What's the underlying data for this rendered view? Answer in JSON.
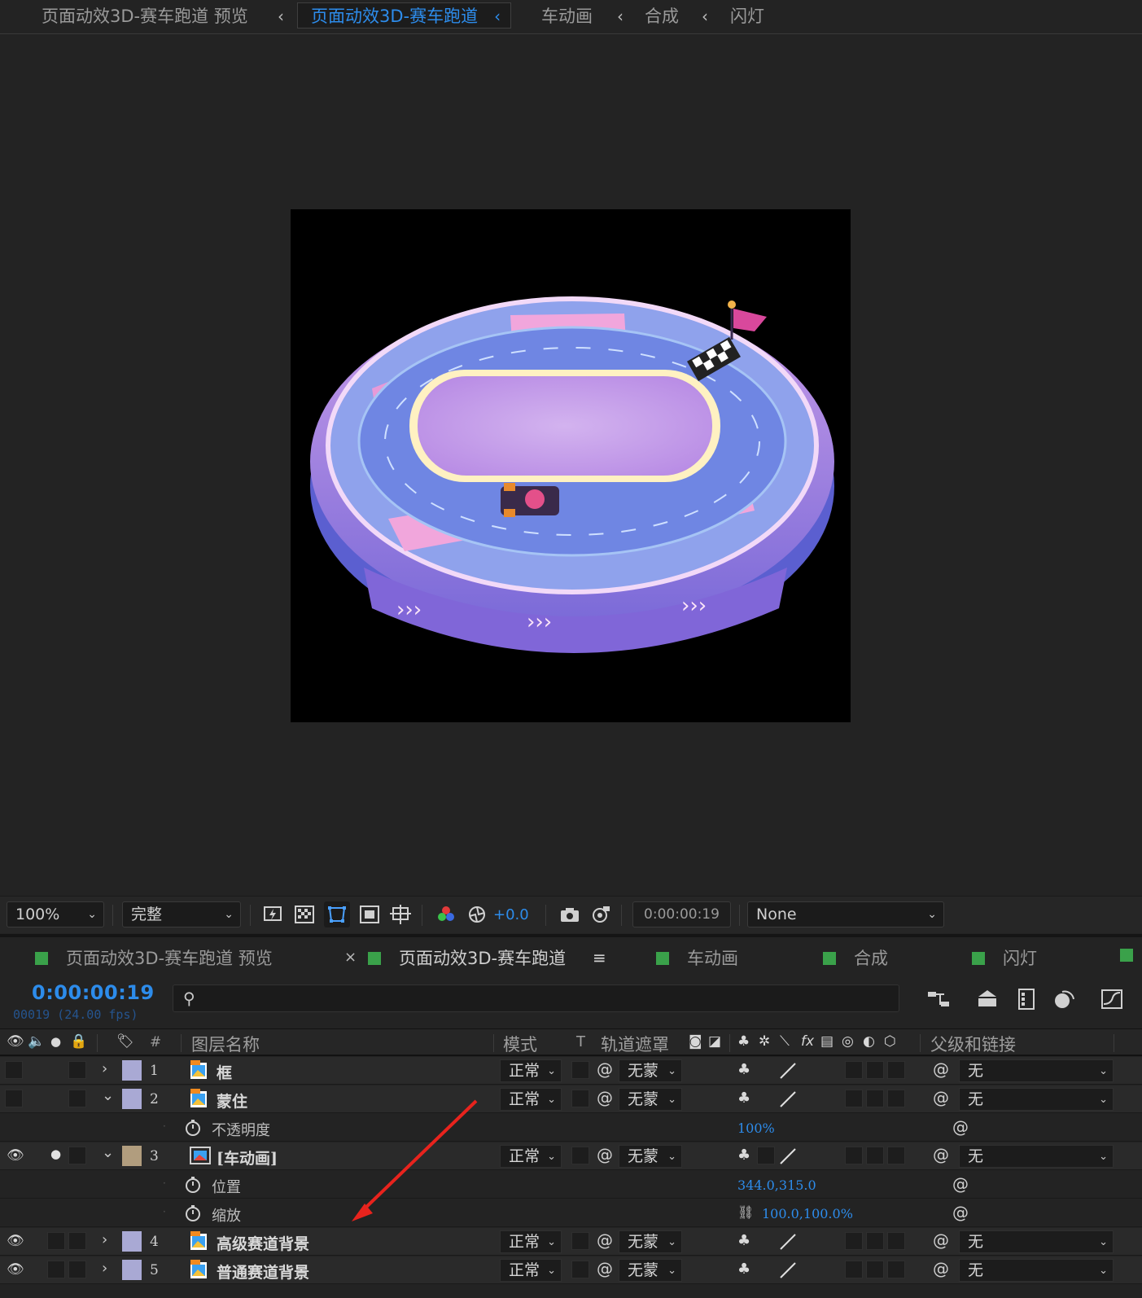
{
  "breadcrumb": {
    "items": [
      "页面动效3D-赛车跑道 预览",
      "页面动效3D-赛车跑道",
      "车动画",
      "合成",
      "闪灯"
    ],
    "active_index": 1
  },
  "viewer_toolbar": {
    "zoom": "100%",
    "resolution": "完整",
    "exposure": "+0.0",
    "current_time": "0:00:00:19",
    "view_option": "None",
    "icons": [
      "fast-preview-icon",
      "transparency-grid-icon",
      "mask-path-visibility-icon",
      "region-of-interest-icon",
      "guides-icon",
      "color-channels-icon",
      "reset-exposure-icon",
      "snapshot-camera-icon",
      "show-snapshot-icon"
    ]
  },
  "timeline_tabs": [
    {
      "label": "页面动效3D-赛车跑道 预览",
      "color": "#3aa14a"
    },
    {
      "label": "页面动效3D-赛车跑道",
      "color": "#3aa14a",
      "active": true
    },
    {
      "label": "车动画",
      "color": "#3aa14a"
    },
    {
      "label": "合成",
      "color": "#3aa14a"
    },
    {
      "label": "闪灯",
      "color": "#3aa14a"
    }
  ],
  "timeline_header": {
    "timecode": "0:00:00:19",
    "framecode": "00019 (24.00 fps)",
    "search_placeholder": ""
  },
  "columns": {
    "number": "#",
    "layer_name": "图层名称",
    "mode": "模式",
    "t": "T",
    "track_matte": "轨道遮罩",
    "parent_link": "父级和链接"
  },
  "layers": [
    {
      "num": "1",
      "name": "框",
      "label_color": "#a9a9d4",
      "mode": "正常",
      "matte": "无蒙",
      "parent": "无",
      "expanded": false,
      "visible": false
    },
    {
      "num": "2",
      "name": "蒙住",
      "label_color": "#a9a9d4",
      "mode": "正常",
      "matte": "无蒙",
      "parent": "无",
      "expanded": true,
      "visible": false,
      "props": [
        {
          "name": "不透明度",
          "value": "100%"
        }
      ]
    },
    {
      "num": "3",
      "name": "[车动画]",
      "label_color": "#b19d7e",
      "mode": "正常",
      "matte": "无蒙",
      "parent": "无",
      "expanded": true,
      "visible": true,
      "solo": true,
      "props": [
        {
          "name": "位置",
          "value": "344.0,315.0"
        },
        {
          "name": "缩放",
          "value": "100.0,100.0%"
        }
      ]
    },
    {
      "num": "4",
      "name": "高级赛道背景",
      "label_color": "#a9a9d4",
      "mode": "正常",
      "matte": "无蒙",
      "parent": "无",
      "expanded": false,
      "visible": true
    },
    {
      "num": "5",
      "name": "普通赛道背景",
      "label_color": "#a9a9d4",
      "mode": "正常",
      "matte": "无蒙",
      "parent": "无",
      "expanded": false,
      "visible": true
    }
  ],
  "annotation": {
    "arrow_color": "#e8231d"
  }
}
